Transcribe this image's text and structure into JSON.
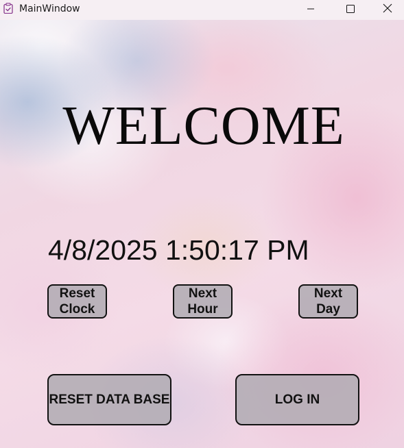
{
  "window": {
    "title": "MainWindow",
    "app_icon": "clipboard-check-icon",
    "controls": {
      "minimize_icon": "minimize-icon",
      "maximize_icon": "maximize-icon",
      "close_icon": "close-icon"
    }
  },
  "main": {
    "heading": "WELCOME",
    "clock_text": "4/8/2025 1:50:17 PM",
    "time_buttons": {
      "reset_clock": "Reset Clock",
      "next_hour": "Next Hour",
      "next_day": "Next Day"
    },
    "actions": {
      "reset_database": "RESET DATA BASE",
      "log_in": "LOG IN"
    }
  },
  "colors": {
    "button_fill": "#b2acb4",
    "button_border": "#111111",
    "text": "#111111",
    "app_icon": "#8a3a8f"
  }
}
